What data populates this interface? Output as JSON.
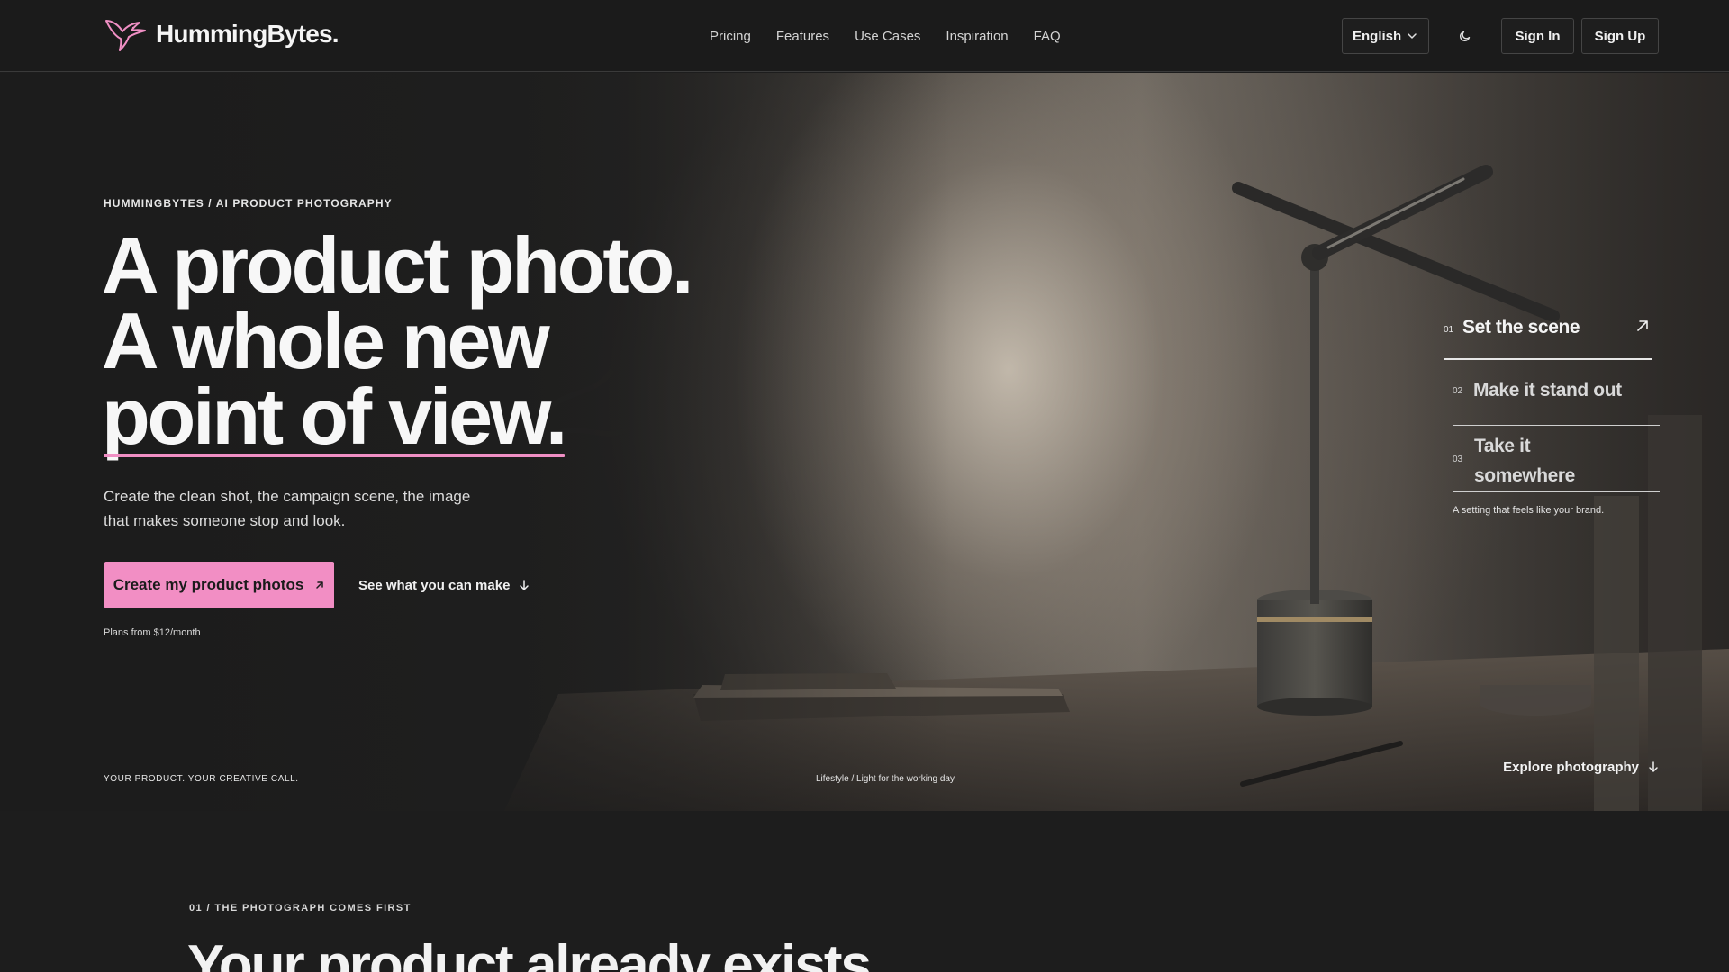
{
  "brand": {
    "name": "HummingBytes.",
    "logo_icon": "hummingbird-icon",
    "accent_color": "#f28ec4"
  },
  "nav": {
    "items": [
      {
        "label": "Pricing"
      },
      {
        "label": "Features"
      },
      {
        "label": "Use Cases"
      },
      {
        "label": "Inspiration"
      },
      {
        "label": "FAQ"
      }
    ]
  },
  "header_actions": {
    "language": "English",
    "theme_icon": "moon-icon",
    "sign_in": "Sign In",
    "sign_up": "Sign Up"
  },
  "hero": {
    "eyebrow": "HUMMINGBYTES / AI PRODUCT PHOTOGRAPHY",
    "headline": {
      "line1": "A product photo.",
      "line2": "A whole new",
      "line3": "point of view."
    },
    "subcopy": "Create the clean shot, the campaign scene, the image that makes someone stop and look.",
    "cta_primary": "Create my product photos",
    "cta_secondary": "See what you can make",
    "plans_note": "Plans from $12/month",
    "steps": [
      {
        "num": "01",
        "title": "Set the scene",
        "active": true
      },
      {
        "num": "02",
        "title": "Make it stand out",
        "active": false
      },
      {
        "num": "03",
        "title": "Take it somewhere",
        "active": false
      }
    ],
    "step_caption": "A setting that feels like your brand.",
    "tagline": "YOUR PRODUCT. YOUR CREATIVE CALL.",
    "image_caption": "Lifestyle / Light for the working day",
    "explore": "Explore photography"
  },
  "section": {
    "eyebrow": "01 / THE PHOTOGRAPH COMES FIRST",
    "title": "Your product already exists."
  }
}
